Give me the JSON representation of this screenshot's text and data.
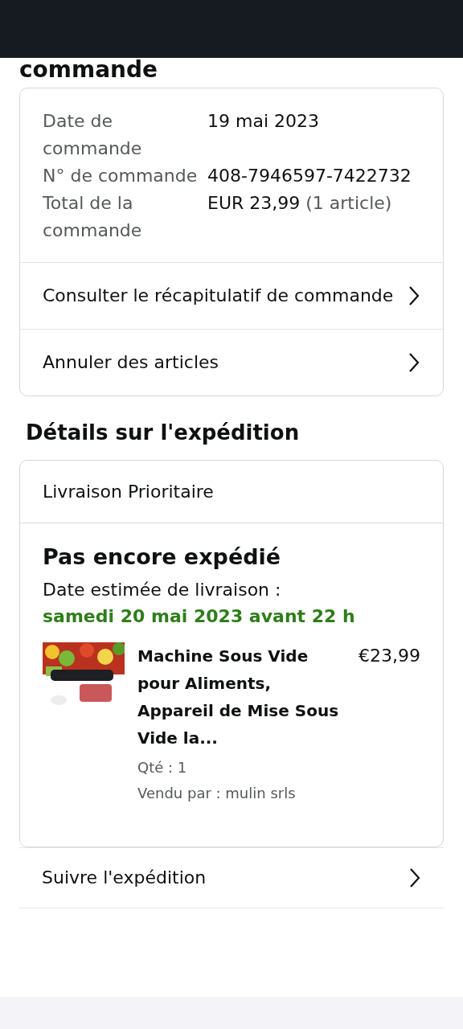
{
  "page_title": "commande",
  "summary": [
    {
      "label": "Date de commande",
      "value": "19 mai 2023"
    },
    {
      "label": "N° de commande",
      "value": "408-7946597-7422732"
    },
    {
      "label": "Total de la commande",
      "value": "EUR 23,99",
      "note": "(1 article)"
    }
  ],
  "links": [
    "Consulter le récapitulatif de commande",
    "Annuler des articles"
  ],
  "shipping": {
    "heading": "Détails sur l'expédition",
    "method": "Livraison Prioritaire",
    "status": "Pas encore expédié",
    "estimate_label": "Date estimée de livraison :",
    "estimate_date": "samedi 20 mai 2023 avant 22 h",
    "item": {
      "kind": "picture",
      "title": "Machine Sous Vide pour Aliments, Appareil de Mise Sous Vide la...",
      "price": "€23,99",
      "qty": "Qté : 1",
      "seller": "Vendu par : mulin srls"
    }
  },
  "track_link": "Suivre l'expédition"
}
